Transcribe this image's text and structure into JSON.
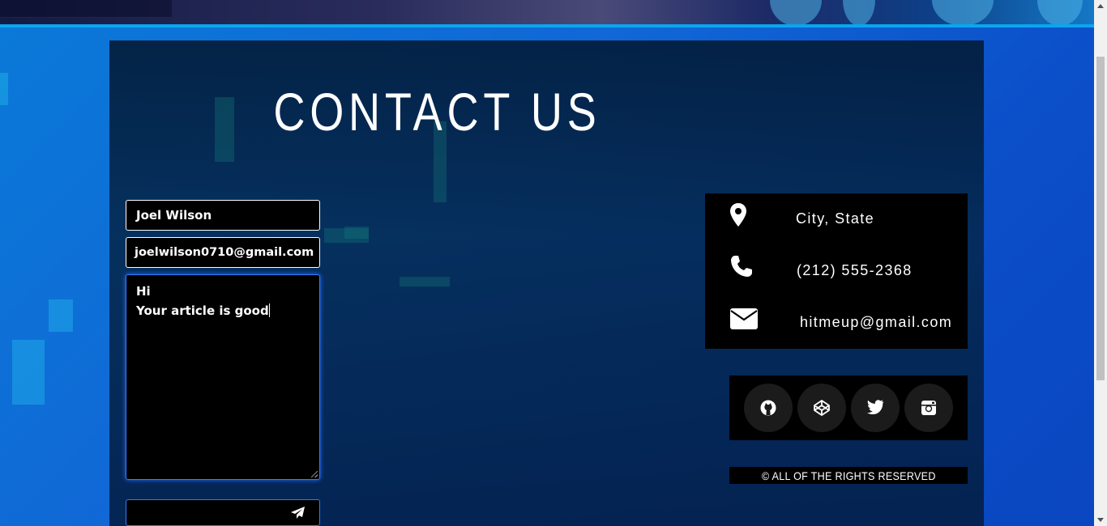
{
  "page": {
    "title": "CONTACT US"
  },
  "form": {
    "name_value": "Joel Wilson",
    "email_value": "joelwilson0710@gmail.com",
    "message_lines": [
      "Hi",
      "Your article is good"
    ]
  },
  "contact_info": {
    "location": "City, State",
    "phone": "(212) 555-2368",
    "email": "hitmeup@gmail.com"
  },
  "social": {
    "items": [
      "github-icon",
      "codepen-icon",
      "twitter-icon",
      "instagram-icon"
    ]
  },
  "footer": {
    "text": "© ALL OF THE RIGHTS RESERVED"
  },
  "colors": {
    "page_background": "#0b5fd0",
    "panel": "#03223f",
    "field_border_focus": "#2f7bff",
    "box_background": "#000000",
    "text": "#ffffff"
  }
}
